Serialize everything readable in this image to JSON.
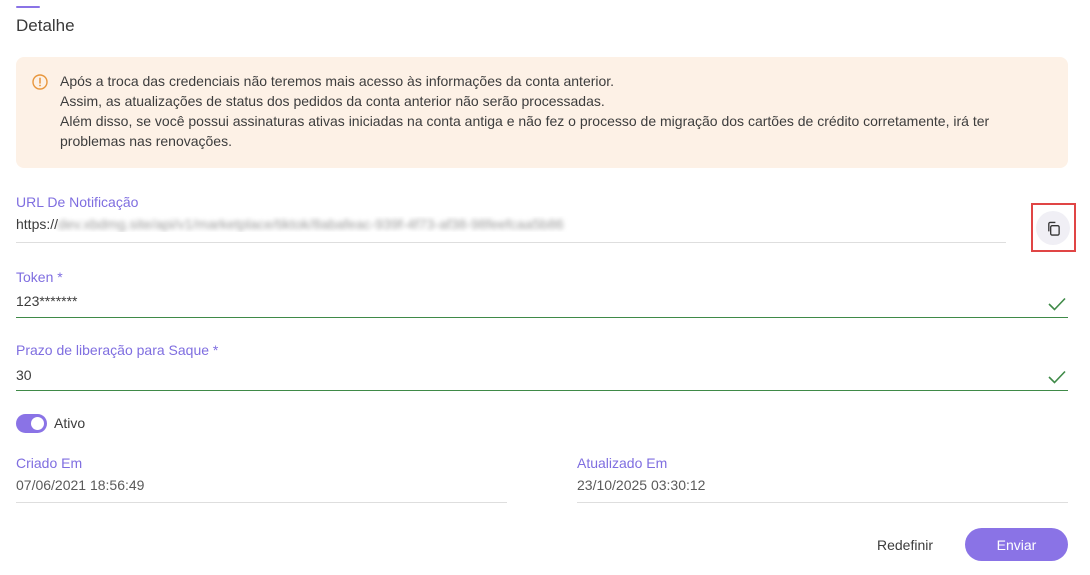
{
  "section": {
    "title": "Detalhe"
  },
  "alert": {
    "icon": "warning-circle-icon",
    "color": "#e8963c",
    "lines": [
      "Após a troca das credenciais não teremos mais acesso às informações da conta anterior.",
      "Assim, as atualizações de status dos pedidos da conta anterior não serão processadas.",
      "Além disso, se você possui assinaturas ativas iniciadas na conta antiga e não fez o processo de migração dos cartões de crédito corretamente, irá ter problemas nas renovações."
    ]
  },
  "notification_url": {
    "label": "URL De Notificação",
    "prefix": "https://",
    "redacted_tail": "dev.xbdmg.site/api/v1/marketplace/tiktok/8abafeac-939f-4f73-af38-98feefcaa5b86",
    "copy_icon": "copy-icon"
  },
  "token": {
    "label": "Token *",
    "value": "123*******",
    "valid_icon": "check-icon"
  },
  "withdrawal": {
    "label": "Prazo de liberação para Saque *",
    "value": "30",
    "valid_icon": "check-icon"
  },
  "status_toggle": {
    "label": "Ativo",
    "on": true
  },
  "created": {
    "label": "Criado Em",
    "value": "07/06/2021 18:56:49"
  },
  "updated": {
    "label": "Atualizado Em",
    "value": "23/10/2025 03:30:12"
  },
  "actions": {
    "reset_label": "Redefinir",
    "submit_label": "Enviar"
  },
  "colors": {
    "accent": "#8a73e6",
    "valid": "#3f8a48",
    "alert_bg": "#fdf1e6",
    "highlight": "#e04545"
  }
}
